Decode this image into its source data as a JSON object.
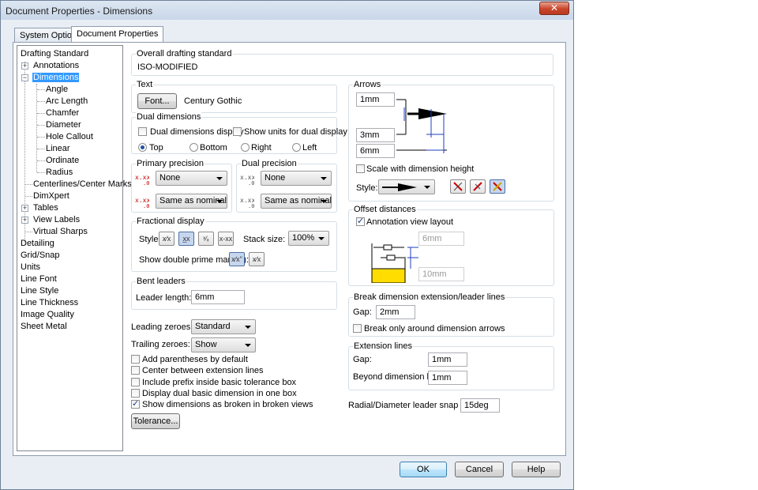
{
  "window": {
    "title": "Document Properties - Dimensions",
    "close_label": "✕"
  },
  "tabs": [
    {
      "label": "System Options"
    },
    {
      "label": "Document Properties"
    }
  ],
  "tree": {
    "items": [
      {
        "label": "Drafting Standard"
      },
      {
        "label": "Annotations"
      },
      {
        "label": "Dimensions"
      },
      {
        "label": "Angle"
      },
      {
        "label": "Arc Length"
      },
      {
        "label": "Chamfer"
      },
      {
        "label": "Diameter"
      },
      {
        "label": "Hole Callout"
      },
      {
        "label": "Linear"
      },
      {
        "label": "Ordinate"
      },
      {
        "label": "Radius"
      },
      {
        "label": "Centerlines/Center Marks"
      },
      {
        "label": "DimXpert"
      },
      {
        "label": "Tables"
      },
      {
        "label": "View Labels"
      },
      {
        "label": "Virtual Sharps"
      },
      {
        "label": "Detailing"
      },
      {
        "label": "Grid/Snap"
      },
      {
        "label": "Units"
      },
      {
        "label": "Line Font"
      },
      {
        "label": "Line Style"
      },
      {
        "label": "Line Thickness"
      },
      {
        "label": "Image Quality"
      },
      {
        "label": "Sheet Metal"
      }
    ]
  },
  "overall": {
    "label": "Overall drafting standard",
    "value": "ISO-MODIFIED"
  },
  "text": {
    "label": "Text",
    "font_button": "Font...",
    "font_name": "Century Gothic"
  },
  "dual": {
    "label": "Dual dimensions",
    "display": "Dual dimensions display",
    "show_units": "Show units for dual display",
    "top": "Top",
    "bottom": "Bottom",
    "right": "Right",
    "left": "Left"
  },
  "primary_precision": {
    "label": "Primary precision",
    "value1": "None",
    "value2": "Same as nominal"
  },
  "dual_precision": {
    "label": "Dual precision",
    "value1": "None",
    "value2": "Same as nominal"
  },
  "fractional": {
    "label": "Fractional display",
    "style_label": "Style:",
    "stack_label": "Stack size:",
    "stack_value": "100%",
    "double_prime": "Show double prime mark (\"):"
  },
  "bent": {
    "label": "Bent leaders",
    "length_label": "Leader length:",
    "length_value": "6mm"
  },
  "zeroes": {
    "leading_label": "Leading zeroes:",
    "leading_value": "Standard",
    "trailing_label": "Trailing zeroes:",
    "trailing_value": "Show"
  },
  "checks": {
    "add_parentheses": "Add parentheses by default",
    "center_between": "Center between extension lines",
    "include_prefix": "Include prefix inside basic tolerance box",
    "display_dual_basic": "Display dual basic dimension in one box",
    "show_broken": "Show dimensions as broken in broken views"
  },
  "tolerance_button": "Tolerance...",
  "arrows": {
    "label": "Arrows",
    "v1": "1mm",
    "v2": "3mm",
    "v3": "6mm",
    "scale_label": "Scale with dimension height",
    "style_label": "Style:"
  },
  "offset": {
    "label": "Offset distances",
    "annotation_layout": "Annotation view layout",
    "v1": "6mm",
    "v2": "10mm"
  },
  "break": {
    "label": "Break dimension extension/leader lines",
    "gap_label": "Gap:",
    "gap_value": "2mm",
    "break_only": "Break only around dimension arrows"
  },
  "extension": {
    "label": "Extension lines",
    "gap_label": "Gap:",
    "gap_value": "1mm",
    "beyond_label": "Beyond dimension line:",
    "beyond_value": "1mm"
  },
  "radial": {
    "label": "Radial/Diameter leader snap angle:",
    "value": "15deg"
  },
  "buttons": {
    "ok": "OK",
    "cancel": "Cancel",
    "help": "Help"
  }
}
